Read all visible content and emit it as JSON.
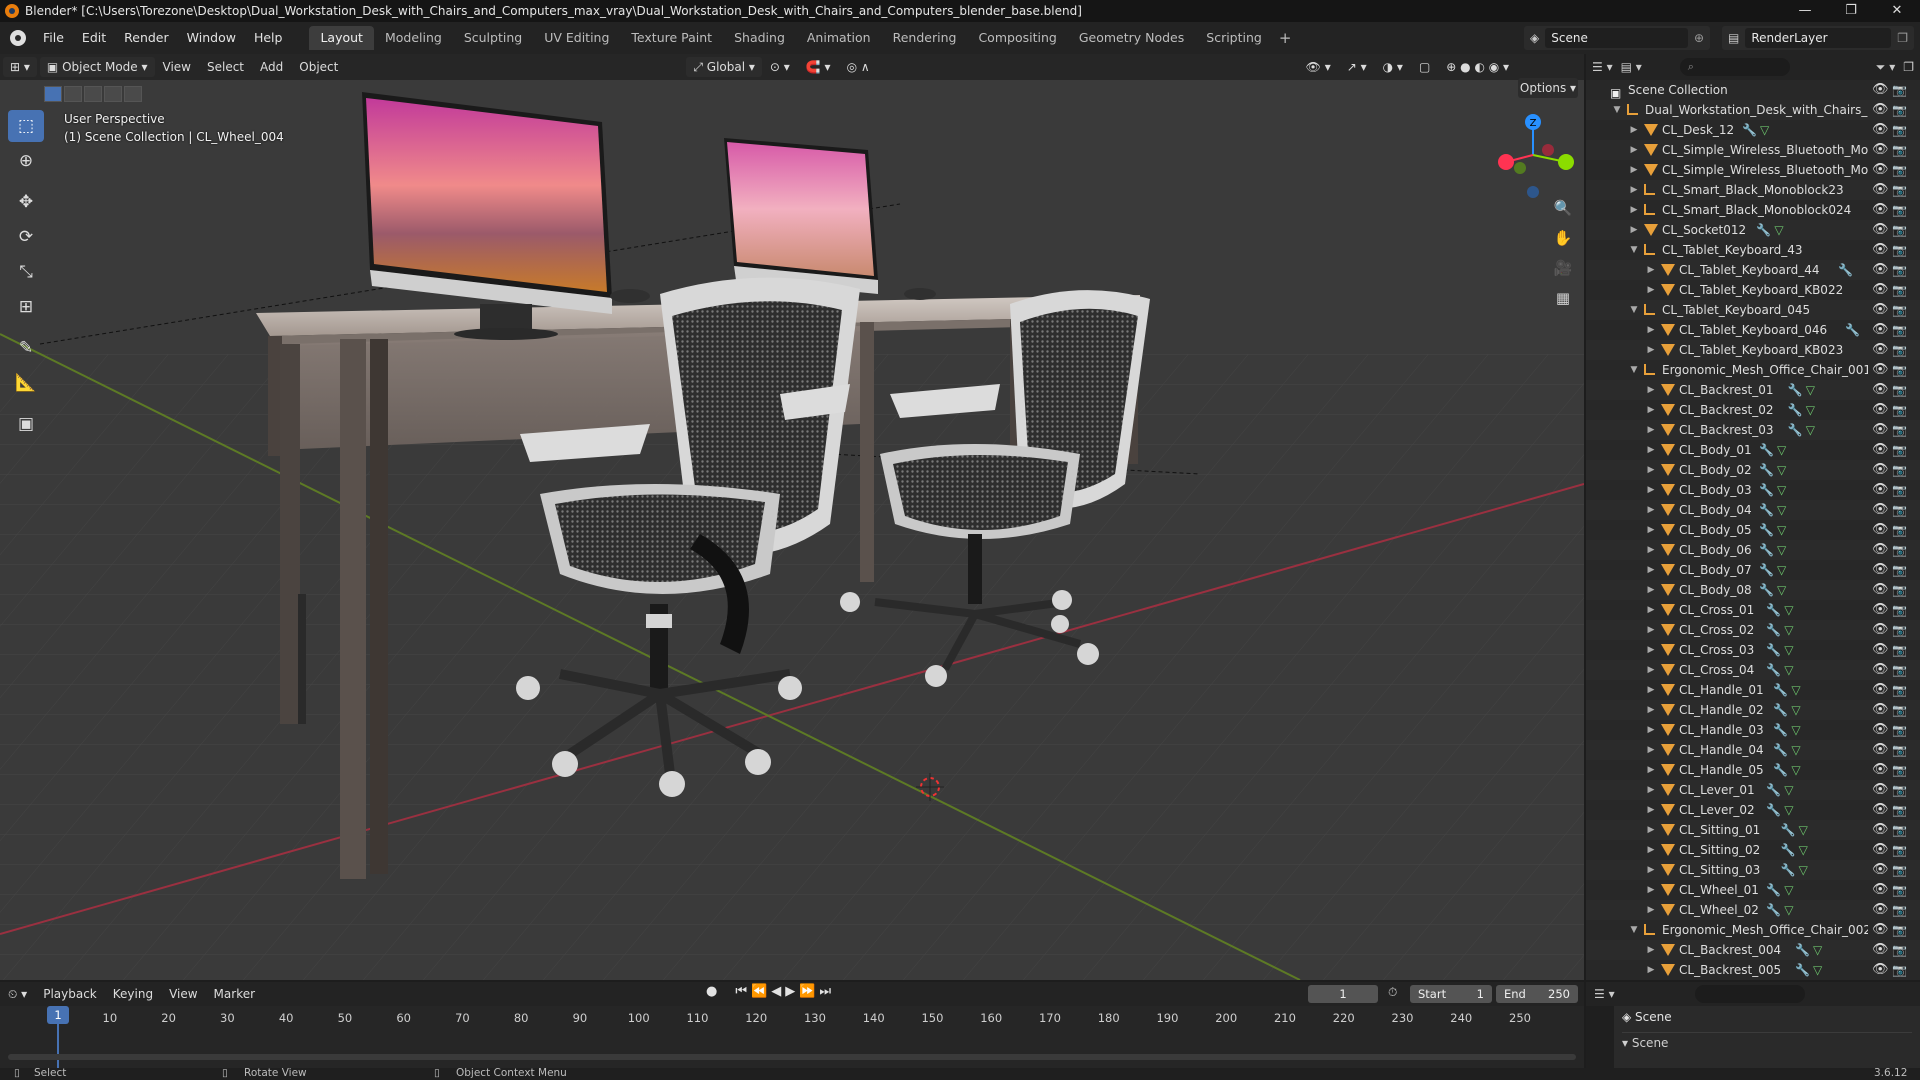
{
  "window": {
    "title": "Blender* [C:\\Users\\Torezone\\Desktop\\Dual_Workstation_Desk_with_Chairs_and_Computers_max_vray\\Dual_Workstation_Desk_with_Chairs_and_Computers_blender_base.blend]",
    "minimize": "—",
    "maximize": "❐",
    "close": "✕"
  },
  "menu": [
    "File",
    "Edit",
    "Render",
    "Window",
    "Help"
  ],
  "workspaces": [
    "Layout",
    "Modeling",
    "Sculpting",
    "UV Editing",
    "Texture Paint",
    "Shading",
    "Animation",
    "Rendering",
    "Compositing",
    "Geometry Nodes",
    "Scripting"
  ],
  "active_workspace": "Layout",
  "scene_name": "Scene",
  "view_layer": "RenderLayer",
  "viewport": {
    "mode": "Object Mode",
    "menus": [
      "View",
      "Select",
      "Add",
      "Object"
    ],
    "orientation": "Global",
    "options": "Options",
    "info_line1": "User Perspective",
    "info_line2": "(1) Scene Collection | CL_Wheel_004",
    "gizmo_axes": [
      "X",
      "Y",
      "Z"
    ]
  },
  "outliner": {
    "root": "Scene Collection",
    "rows": [
      {
        "depth": 0,
        "type": "collection",
        "label": "Scene Collection",
        "expanded": true,
        "mod": false,
        "data": false
      },
      {
        "depth": 1,
        "type": "empty",
        "label": "Dual_Workstation_Desk_with_Chairs_ar",
        "expanded": true,
        "mod": false,
        "data": false
      },
      {
        "depth": 2,
        "type": "mesh",
        "label": "CL_Desk_12",
        "expanded": false,
        "mod": true,
        "data": true
      },
      {
        "depth": 2,
        "type": "mesh",
        "label": "CL_Simple_Wireless_Bluetooth_Mou",
        "expanded": false,
        "mod": false,
        "data": false
      },
      {
        "depth": 2,
        "type": "mesh",
        "label": "CL_Simple_Wireless_Bluetooth_Mou",
        "expanded": false,
        "mod": false,
        "data": false
      },
      {
        "depth": 2,
        "type": "empty",
        "label": "CL_Smart_Black_Monoblock23",
        "expanded": false,
        "mod": false,
        "data": false
      },
      {
        "depth": 2,
        "type": "empty",
        "label": "CL_Smart_Black_Monoblock024",
        "expanded": false,
        "mod": false,
        "data": false
      },
      {
        "depth": 2,
        "type": "mesh",
        "label": "CL_Socket012",
        "expanded": false,
        "mod": true,
        "data": true
      },
      {
        "depth": 2,
        "type": "empty",
        "label": "CL_Tablet_Keyboard_43",
        "expanded": true,
        "mod": false,
        "data": false
      },
      {
        "depth": 3,
        "type": "mesh",
        "label": "CL_Tablet_Keyboard_44",
        "expanded": false,
        "mod": true,
        "data": false
      },
      {
        "depth": 3,
        "type": "mesh",
        "label": "CL_Tablet_Keyboard_KB022",
        "expanded": false,
        "mod": false,
        "data": false
      },
      {
        "depth": 2,
        "type": "empty",
        "label": "CL_Tablet_Keyboard_045",
        "expanded": true,
        "mod": false,
        "data": false
      },
      {
        "depth": 3,
        "type": "mesh",
        "label": "CL_Tablet_Keyboard_046",
        "expanded": false,
        "mod": true,
        "data": false
      },
      {
        "depth": 3,
        "type": "mesh",
        "label": "CL_Tablet_Keyboard_KB023",
        "expanded": false,
        "mod": false,
        "data": false
      },
      {
        "depth": 2,
        "type": "empty",
        "label": "Ergonomic_Mesh_Office_Chair_001",
        "expanded": true,
        "mod": false,
        "data": false
      },
      {
        "depth": 3,
        "type": "mesh",
        "label": "CL_Backrest_01",
        "expanded": false,
        "mod": true,
        "data": true
      },
      {
        "depth": 3,
        "type": "mesh",
        "label": "CL_Backrest_02",
        "expanded": false,
        "mod": true,
        "data": true
      },
      {
        "depth": 3,
        "type": "mesh",
        "label": "CL_Backrest_03",
        "expanded": false,
        "mod": true,
        "data": true
      },
      {
        "depth": 3,
        "type": "mesh",
        "label": "CL_Body_01",
        "expanded": false,
        "mod": true,
        "data": true
      },
      {
        "depth": 3,
        "type": "mesh",
        "label": "CL_Body_02",
        "expanded": false,
        "mod": true,
        "data": true
      },
      {
        "depth": 3,
        "type": "mesh",
        "label": "CL_Body_03",
        "expanded": false,
        "mod": true,
        "data": true
      },
      {
        "depth": 3,
        "type": "mesh",
        "label": "CL_Body_04",
        "expanded": false,
        "mod": true,
        "data": true
      },
      {
        "depth": 3,
        "type": "mesh",
        "label": "CL_Body_05",
        "expanded": false,
        "mod": true,
        "data": true
      },
      {
        "depth": 3,
        "type": "mesh",
        "label": "CL_Body_06",
        "expanded": false,
        "mod": true,
        "data": true
      },
      {
        "depth": 3,
        "type": "mesh",
        "label": "CL_Body_07",
        "expanded": false,
        "mod": true,
        "data": true
      },
      {
        "depth": 3,
        "type": "mesh",
        "label": "CL_Body_08",
        "expanded": false,
        "mod": true,
        "data": true
      },
      {
        "depth": 3,
        "type": "mesh",
        "label": "CL_Cross_01",
        "expanded": false,
        "mod": true,
        "data": true
      },
      {
        "depth": 3,
        "type": "mesh",
        "label": "CL_Cross_02",
        "expanded": false,
        "mod": true,
        "data": true
      },
      {
        "depth": 3,
        "type": "mesh",
        "label": "CL_Cross_03",
        "expanded": false,
        "mod": true,
        "data": true
      },
      {
        "depth": 3,
        "type": "mesh",
        "label": "CL_Cross_04",
        "expanded": false,
        "mod": true,
        "data": true
      },
      {
        "depth": 3,
        "type": "mesh",
        "label": "CL_Handle_01",
        "expanded": false,
        "mod": true,
        "data": true
      },
      {
        "depth": 3,
        "type": "mesh",
        "label": "CL_Handle_02",
        "expanded": false,
        "mod": true,
        "data": true
      },
      {
        "depth": 3,
        "type": "mesh",
        "label": "CL_Handle_03",
        "expanded": false,
        "mod": true,
        "data": true
      },
      {
        "depth": 3,
        "type": "mesh",
        "label": "CL_Handle_04",
        "expanded": false,
        "mod": true,
        "data": true
      },
      {
        "depth": 3,
        "type": "mesh",
        "label": "CL_Handle_05",
        "expanded": false,
        "mod": true,
        "data": true
      },
      {
        "depth": 3,
        "type": "mesh",
        "label": "CL_Lever_01",
        "expanded": false,
        "mod": true,
        "data": true
      },
      {
        "depth": 3,
        "type": "mesh",
        "label": "CL_Lever_02",
        "expanded": false,
        "mod": true,
        "data": true
      },
      {
        "depth": 3,
        "type": "mesh",
        "label": "CL_Sitting_01",
        "expanded": false,
        "mod": true,
        "data": true
      },
      {
        "depth": 3,
        "type": "mesh",
        "label": "CL_Sitting_02",
        "expanded": false,
        "mod": true,
        "data": true
      },
      {
        "depth": 3,
        "type": "mesh",
        "label": "CL_Sitting_03",
        "expanded": false,
        "mod": true,
        "data": true
      },
      {
        "depth": 3,
        "type": "mesh",
        "label": "CL_Wheel_01",
        "expanded": false,
        "mod": true,
        "data": true
      },
      {
        "depth": 3,
        "type": "mesh",
        "label": "CL_Wheel_02",
        "expanded": false,
        "mod": true,
        "data": true
      },
      {
        "depth": 2,
        "type": "empty",
        "label": "Ergonomic_Mesh_Office_Chair_002",
        "expanded": true,
        "mod": false,
        "data": false
      },
      {
        "depth": 3,
        "type": "mesh",
        "label": "CL_Backrest_004",
        "expanded": false,
        "mod": true,
        "data": true
      },
      {
        "depth": 3,
        "type": "mesh",
        "label": "CL_Backrest_005",
        "expanded": false,
        "mod": true,
        "data": true
      }
    ]
  },
  "properties": {
    "scene_label": "Scene",
    "subpanel": "Scene"
  },
  "timeline": {
    "menus": [
      "Playback",
      "Keying",
      "View",
      "Marker"
    ],
    "current_frame": "1",
    "start_label": "Start",
    "start": "1",
    "end_label": "End",
    "end": "250",
    "ticks": [
      "10",
      "20",
      "30",
      "40",
      "50",
      "60",
      "70",
      "80",
      "90",
      "100",
      "110",
      "120",
      "130",
      "140",
      "150",
      "160",
      "170",
      "180",
      "190",
      "200",
      "210",
      "220",
      "230",
      "240",
      "250"
    ]
  },
  "statusbar": {
    "select": "Select",
    "rotate": "Rotate View",
    "context": "Object Context Menu",
    "version": "3.6.12"
  },
  "colors": {
    "accent": "#4772b3",
    "axis_x": "#ff3352",
    "axis_y": "#8bdc00",
    "axis_z": "#2890ff",
    "object_orange": "#e8a03a"
  }
}
